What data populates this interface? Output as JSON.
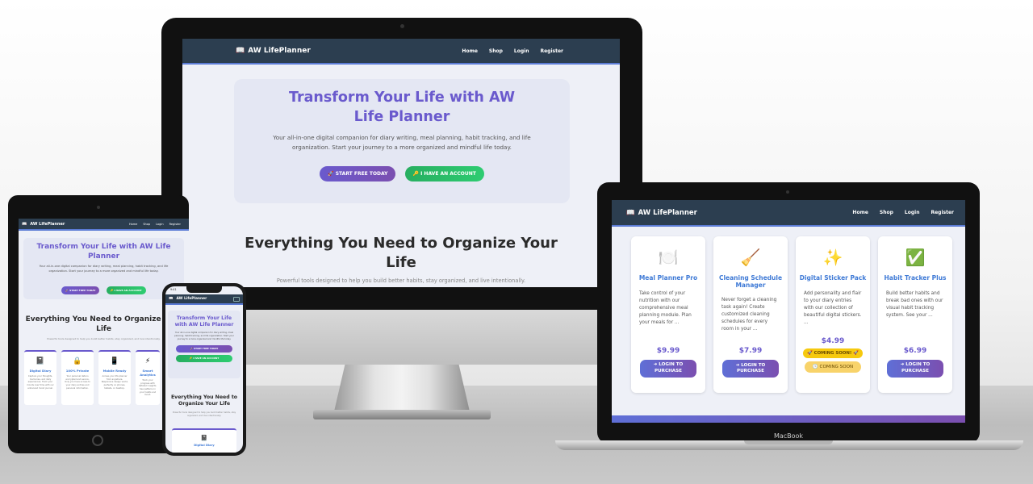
{
  "brand": "AW LifePlanner",
  "nav": [
    "Home",
    "Shop",
    "Login",
    "Register"
  ],
  "hero": {
    "title": "Transform Your Life with AW Life Planner",
    "text": "Your all-in-one digital companion for diary writing, meal planning, habit tracking, and life organization. Start your journey to a more organized and mindful life today.",
    "btn_start": "🚀 START FREE TODAY",
    "btn_account": "🔑 I HAVE AN ACCOUNT"
  },
  "features": {
    "title": "Everything You Need to Organize Your Life",
    "subtitle": "Powerful tools designed to help you build better habits, stay organized, and live intentionally.",
    "items": [
      {
        "icon": "📓",
        "name": "Digital Diary",
        "desc": "Capture your thoughts, memories, and daily experiences. Track your moods over time with our enhanced mood journal."
      },
      {
        "icon": "🔒",
        "name": "100% Private",
        "desc": "Your personal data is encrypted and secure. Only you have access to your diary entries and personal information."
      },
      {
        "icon": "📱",
        "name": "Mobile Ready",
        "desc": "Access your life planner from anywhere. Responsive design works perfectly on phones, tablets, or desktop."
      },
      {
        "icon": "⚡",
        "name": "Smart Analytics",
        "desc": "Track your progress with detailed insights. See patterns in your habits and mood."
      }
    ]
  },
  "products": [
    {
      "icon": "🍽️",
      "name": "Meal Planner Pro",
      "desc": "Take control of your nutrition with our comprehensive meal planning module. Plan your meals for ...",
      "price": "$9.99",
      "action": "➜ LOGIN TO PURCHASE"
    },
    {
      "icon": "🧹",
      "name": "Cleaning Schedule Manager",
      "desc": "Never forget a cleaning task again! Create customized cleaning schedules for every room in your ...",
      "price": "$7.99",
      "action": "➜ LOGIN TO PURCHASE"
    },
    {
      "icon": "✨",
      "name": "Digital Sticker Pack",
      "desc": "Add personality and flair to your diary entries with our collection of beautiful digital stickers. ...",
      "price": "$4.99",
      "badge": "🚀 COMING SOON! 🚀",
      "action": "🕒 COMING SOON"
    },
    {
      "icon": "✅",
      "name": "Habit Tracker Plus",
      "desc": "Build better habits and break bad ones with our visual habit tracking system. See your ...",
      "price": "$6.99",
      "action": "➜ LOGIN TO PURCHASE"
    }
  ],
  "device": {
    "laptop_label": "MacBook",
    "phone_time": "9:41"
  },
  "colors": {
    "nav": "#2c3e50",
    "accent": "#6a5acd",
    "green": "#2ecc71",
    "link": "#3f7ad6"
  }
}
